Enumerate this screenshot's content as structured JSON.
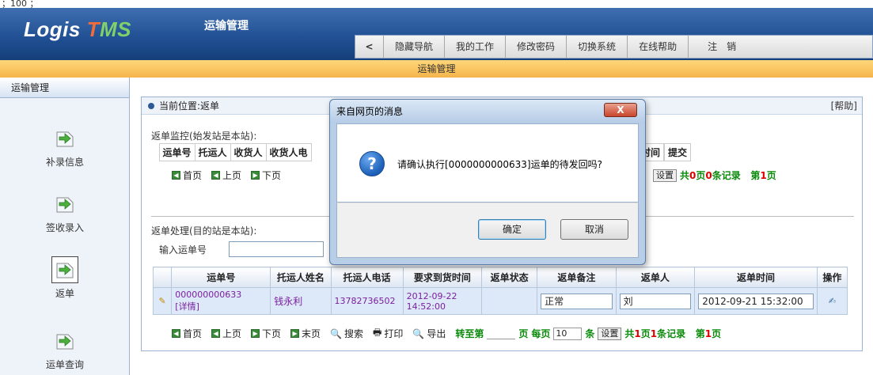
{
  "topline": "；100 ；",
  "brand": {
    "logo_main": "Logis ",
    "logo_t": "T",
    "logo_ms": "MS",
    "app_title": "运输管理"
  },
  "nav": {
    "back": "<",
    "items": [
      "隐藏导航",
      "我的工作",
      "修改密码",
      "切换系统",
      "在线帮助",
      "注　销"
    ]
  },
  "banner": "运输管理",
  "sidebar": {
    "header": "运输管理",
    "items": [
      {
        "label": "补录信息",
        "icon": "arrow-doc-icon"
      },
      {
        "label": "签收录入",
        "icon": "arrow-doc-icon"
      },
      {
        "label": "返单",
        "icon": "arrow-doc-icon"
      },
      {
        "label": "运单查询",
        "icon": "arrow-doc-icon"
      }
    ]
  },
  "panel": {
    "location": "当前位置:返单",
    "help": "[帮助]",
    "monitor_label": "返单监控(始发站是本站):",
    "monitor_cols": [
      "运单号",
      "托运人",
      "收货人",
      "收货人电",
      "时间",
      "提交"
    ],
    "pager1": {
      "first": "首页",
      "prev": "上页",
      "next": "下页",
      "set": "设置",
      "summary_a": "共",
      "pages": "0",
      "summary_b": "页",
      "records": "0",
      "summary_c": "条记录",
      "page_a": "第",
      "page": "1",
      "page_b": "页"
    },
    "process_label": "返单处理(目的站是本站):",
    "input_label": "输入运单号",
    "grid": {
      "headers": [
        "",
        "运单号",
        "托运人姓名",
        "托运人电话",
        "要求到货时间",
        "返单状态",
        "返单备注",
        "返单人",
        "返单时间",
        "操作"
      ],
      "rows": [
        {
          "waybill": "000000000633",
          "detail": "[详情]",
          "shipper": "钱永利",
          "phone": "13782736502",
          "due_date": "2012-09-22",
          "due_time": "14:52:00",
          "status": "",
          "remark": "正常",
          "person": "刘",
          "time": "2012-09-21 15:32:00"
        }
      ]
    },
    "pager2": {
      "first": "首页",
      "prev": "上页",
      "next": "下页",
      "last": "末页",
      "search": "搜索",
      "print": "打印",
      "export": "导出",
      "goto": "转至第",
      "page_unit": "页",
      "per_page": "每页",
      "per_value": "10",
      "items_unit": "条",
      "set": "设置",
      "summary_a": "共",
      "pages": "1",
      "summary_b": "页",
      "records": "1",
      "summary_c": "条记录",
      "page_a": "第",
      "page": "1",
      "page_b": "页"
    }
  },
  "dialog": {
    "title": "来自网页的消息",
    "close": "X",
    "message": "请确认执行[0000000000633]运单的待发回吗?",
    "ok": "确定",
    "cancel": "取消"
  }
}
